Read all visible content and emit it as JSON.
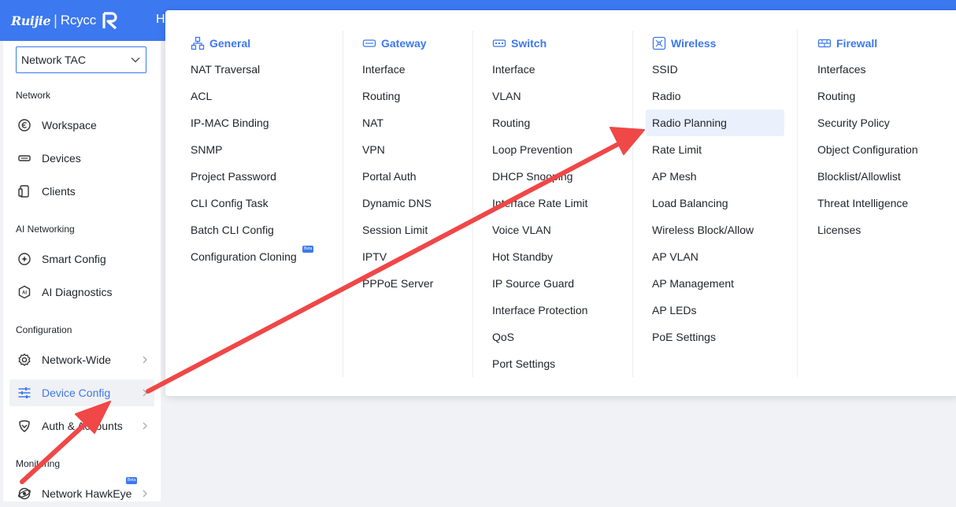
{
  "brand": {
    "name": "Ruijie",
    "sub": "Rcycc"
  },
  "top_tab_partial": "H",
  "sidebar": {
    "selector_value": "Network TAC",
    "groups": [
      {
        "title": "Network",
        "items": [
          {
            "label": "Workspace",
            "icon": "workspace-icon"
          },
          {
            "label": "Devices",
            "icon": "devices-icon"
          },
          {
            "label": "Clients",
            "icon": "clients-icon"
          }
        ]
      },
      {
        "title": "AI Networking",
        "items": [
          {
            "label": "Smart Config",
            "icon": "smart-config-icon"
          },
          {
            "label": "AI Diagnostics",
            "icon": "ai-diagnostics-icon"
          }
        ]
      },
      {
        "title": "Configuration",
        "items": [
          {
            "label": "Network-Wide",
            "icon": "gear-icon",
            "chevron": true
          },
          {
            "label": "Device Config",
            "icon": "sliders-icon",
            "chevron": true,
            "active": true
          },
          {
            "label": "Auth & Accounts",
            "icon": "shield-icon",
            "chevron": true
          }
        ]
      },
      {
        "title": "Monitoring",
        "items": [
          {
            "label": "Network HawkEye",
            "icon": "hawkeye-icon",
            "chevron": true,
            "badge": "Beta"
          }
        ]
      }
    ]
  },
  "menu": {
    "columns": [
      {
        "title": "General",
        "icon": "general-icon",
        "items": [
          "NAT Traversal",
          "ACL",
          "IP-MAC Binding",
          "SNMP",
          "Project Password",
          "CLI Config Task",
          "Batch CLI Config",
          "Configuration Cloning"
        ],
        "badge_item": "Configuration Cloning",
        "badge": "Beta"
      },
      {
        "title": "Gateway",
        "icon": "gateway-icon",
        "items": [
          "Interface",
          "Routing",
          "NAT",
          "VPN",
          "Portal Auth",
          "Dynamic DNS",
          "Session Limit",
          "IPTV",
          "PPPoE Server"
        ]
      },
      {
        "title": "Switch",
        "icon": "switch-icon",
        "items": [
          "Interface",
          "VLAN",
          "Routing",
          "Loop Prevention",
          "DHCP Snooping",
          "Interface Rate Limit",
          "Voice VLAN",
          "Hot Standby",
          "IP Source Guard",
          "Interface Protection",
          "QoS",
          "Port Settings"
        ]
      },
      {
        "title": "Wireless",
        "icon": "wireless-icon",
        "items": [
          "SSID",
          "Radio",
          "Radio Planning",
          "Rate Limit",
          "AP Mesh",
          "Load Balancing",
          "Wireless Block/Allow",
          "AP VLAN",
          "AP Management",
          "AP LEDs",
          "PoE Settings"
        ],
        "highlighted": "Radio Planning"
      },
      {
        "title": "Firewall",
        "icon": "firewall-icon",
        "items": [
          "Interfaces",
          "Routing",
          "Security Policy",
          "Object Configuration",
          "Blocklist/Allowlist",
          "Threat Intelligence",
          "Licenses"
        ]
      }
    ]
  },
  "colors": {
    "accent": "#3c78ef",
    "arrow": "#f04747",
    "highlight_bg": "#ebf0fd",
    "active_bg": "#f0f1f4"
  }
}
